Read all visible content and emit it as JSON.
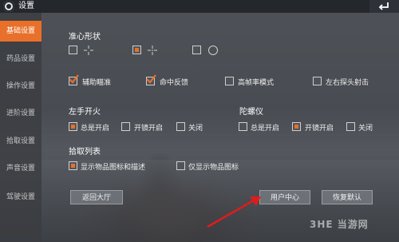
{
  "header": {
    "title": "设置"
  },
  "sidebar": {
    "items": [
      {
        "label": "基础设置",
        "active": true
      },
      {
        "label": "药品设置"
      },
      {
        "label": "操作设置"
      },
      {
        "label": "进阶设置"
      },
      {
        "label": "拾取设置"
      },
      {
        "label": "声音设置"
      },
      {
        "label": "驾驶设置"
      }
    ]
  },
  "crosshair": {
    "heading": "准心形状"
  },
  "toggles": [
    {
      "label": "辅助瞄准",
      "checked": true
    },
    {
      "label": "命中反馈",
      "checked": true
    },
    {
      "label": "高帧率模式",
      "checked": false
    },
    {
      "label": "左右探头射击",
      "checked": false
    }
  ],
  "left_fire": {
    "heading": "左手开火",
    "options": [
      "总是开启",
      "开镜开启",
      "关闭"
    ],
    "selected": "总是开启"
  },
  "gyro": {
    "heading": "陀螺仪",
    "options": [
      "总是开启",
      "开镜开启",
      "关闭"
    ],
    "selected": "开镜开启"
  },
  "pickup": {
    "heading": "拾取列表",
    "options": [
      "显示物品图标和描述",
      "仅显示物品图标"
    ],
    "selected": "显示物品图标和描述"
  },
  "buttons": {
    "back_lobby": "返回大厅",
    "user_center": "用户中心",
    "restore_default": "恢复默认"
  },
  "watermark": "3HE 当游网",
  "colors": {
    "accent": "#e8702a",
    "check": "#e8702a"
  }
}
